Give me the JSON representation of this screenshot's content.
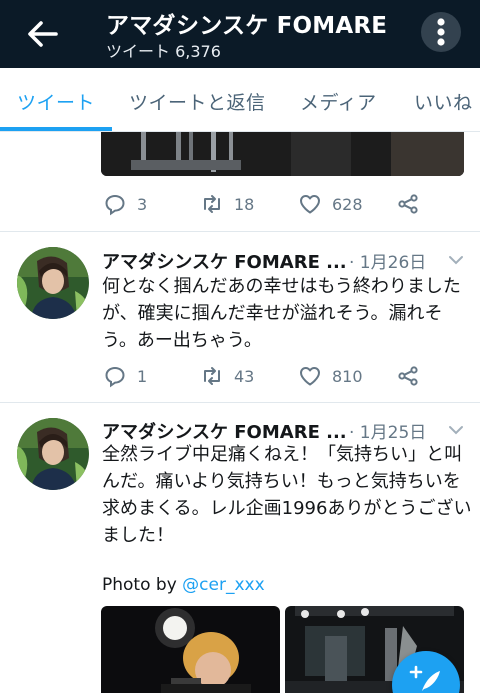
{
  "header": {
    "title": "アマダシンスケ FOMARE",
    "subtitle": "ツイート 6,376"
  },
  "tabs": [
    {
      "label": "ツイート"
    },
    {
      "label": "ツイートと返信"
    },
    {
      "label": "メディア"
    },
    {
      "label": "いいね"
    }
  ],
  "tweets": [
    {
      "replies": "3",
      "retweets": "18",
      "likes": "628"
    },
    {
      "author": "アマダシンスケ FOMARE ...",
      "date": "· 1月26日",
      "text": "何となく掴んだあの幸せはもう終わりましたが、確実に掴んだ幸せが溢れそう。漏れそう。あー出ちゃう。",
      "replies": "1",
      "retweets": "43",
      "likes": "810"
    },
    {
      "author": "アマダシンスケ FOMARE ...",
      "date": "· 1月25日",
      "text": "全然ライブ中足痛くねえ！「気持ちい」と叫んだ。痛いより気持ちい！もっと気持ちいを求めまくる。レル企画1996ありがとうございました！",
      "photo_by_label": "Photo by ",
      "photo_by_handle": "@cer_xxx"
    }
  ],
  "colors": {
    "header_bg": "#0b1a27",
    "accent": "#1da1f2",
    "muted": "#657786"
  }
}
